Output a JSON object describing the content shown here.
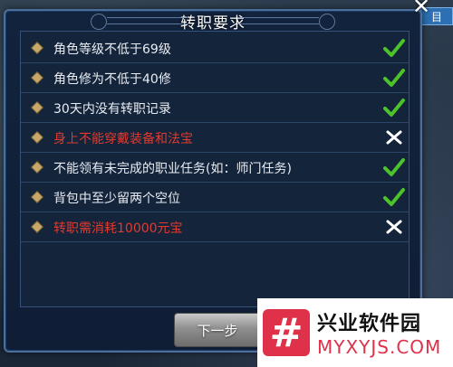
{
  "background": {
    "top_text": "",
    "corner_label": "目"
  },
  "dialog": {
    "title": "转职要求",
    "close_glyph": "✕",
    "next_button_label": "下一步"
  },
  "requirements": [
    {
      "label": "角色等级不低于69级",
      "met": true
    },
    {
      "label": "角色修为不低于40修",
      "met": true
    },
    {
      "label": "30天内没有转职记录",
      "met": true
    },
    {
      "label": "身上不能穿戴装备和法宝",
      "met": false
    },
    {
      "label": "不能领有未完成的职业任务(如：师门任务)",
      "met": true
    },
    {
      "label": "背包中至少留两个空位",
      "met": true
    },
    {
      "label": "转职需消耗10000元宝",
      "met": false
    }
  ],
  "colors": {
    "met_check": "#4cc32a",
    "unmet_cross": "#ffffff",
    "unmet_text": "#e23a2e",
    "normal_text": "#e8ecf2"
  },
  "watermark": {
    "logo_glyph": "#",
    "name": "兴业软件园",
    "url": "MYXYJS.COM"
  }
}
